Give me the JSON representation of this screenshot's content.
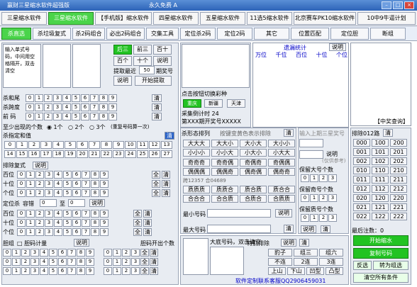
{
  "app": {
    "title": "赢财三星缩水软件超强版",
    "center": "永久免费 A"
  },
  "tabs": [
    "三星缩水软件",
    "三星缩水软件",
    "【手机版】缩水软件",
    "四星缩水软件",
    "五星缩水软件",
    "11选5缩水软件",
    "北京赛车PK10缩水软件",
    "10中9牛逼计划"
  ],
  "toolbar": [
    "杀直选",
    "杀垃圾复式",
    "杀2码组合",
    "必出2码组合",
    "交集工具",
    "定位杀2码",
    "定位2码",
    "其它",
    "位置匹配",
    "定位胆",
    "断组"
  ],
  "input": {
    "hint": "输入单式号码，中间用空格隔开，双击清空"
  },
  "extract": {
    "b1": "后三",
    "b2": "前三",
    "b3": "百十",
    "b4": "百个",
    "b5": "十个",
    "b6": "说明",
    "recent_label": "提取最近",
    "recent_value": "50",
    "period_label": "期奖号",
    "extract_btn": "开始提取",
    "explain": "说明"
  },
  "sumrows": {
    "hz": "杀和尾",
    "kd": "杀跨度",
    "qm": "前 码",
    "clear": "清"
  },
  "atleast": {
    "label": "至少出现的个数",
    "o1": "1个",
    "o2": "2个",
    "o3": "3个",
    "note": "(重复号码算一次)"
  },
  "killdan": {
    "label": "杀指定和值",
    "clear": "清"
  },
  "pos3": {
    "title": "排除复式",
    "explain": "说明",
    "rows": [
      "百位",
      "十位",
      "个位"
    ],
    "all": "全",
    "clear": "清"
  },
  "posdel": {
    "title": "定位杀",
    "label": "容错",
    "from": "0",
    "to_label": "至",
    "to": "0",
    "explain": "说明",
    "rows": [
      "百位",
      "十位",
      "个位"
    ],
    "all": "全",
    "clear": "清"
  },
  "lottery": {
    "title": "点击按钮切换彩种",
    "chongqing": "重庆",
    "xinjiang": "新疆",
    "tianjin": "天津",
    "countdown": "采集倒计时 24",
    "period": "第XXX期开奖号XXXXX"
  },
  "trend": {
    "title": "遗漏统计",
    "explain": "说明",
    "cols": [
      "万位",
      "千位",
      "百位",
      "十位",
      "个位"
    ]
  },
  "query": {
    "label": "【中奖查询】"
  },
  "shape": {
    "title": "杀形态排列",
    "sub": "按键变黄色表示排除",
    "clear": "清",
    "items": [
      "大大大",
      "大大小",
      "大小大",
      "大小小",
      "小小小",
      "小小大",
      "小大小",
      "小大大",
      "奇奇奇",
      "奇奇偶",
      "奇偶奇",
      "奇偶偶",
      "偶偶偶",
      "偶偶奇",
      "偶奇偶",
      "偶奇奇"
    ],
    "bars": [
      "质质质",
      "质质合",
      "质合质",
      "质合合",
      "合合合",
      "合合质",
      "合质合",
      "合质质"
    ],
    "note": "跨12357 合04689"
  },
  "minmax": {
    "min": "最小号码",
    "max": "最大号码",
    "explain": "说明",
    "clear": "清"
  },
  "award": {
    "title": "输入上期三星奖号",
    "explain": "说明",
    "note": "(仅供参考)"
  },
  "keep": {
    "big": "保留大号个数",
    "odd": "保留奇号个数",
    "prime": "保留质号个数"
  },
  "sort": {
    "title": "排除012路",
    "clear": "清",
    "items": [
      "000",
      "100",
      "200",
      "001",
      "101",
      "201",
      "002",
      "102",
      "202",
      "010",
      "110",
      "210",
      "011",
      "111",
      "211",
      "012",
      "112",
      "212",
      "020",
      "120",
      "220",
      "021",
      "121",
      "221",
      "022",
      "122",
      "222"
    ]
  },
  "bottom": {
    "group": "胆组",
    "bile_count": "胆码计量",
    "explain": "说明",
    "bile_open": "胆码开出个数",
    "bigbase": "大底号码，双击清空",
    "special": "特别排除",
    "sp": [
      "豹子",
      "组三",
      "组六",
      "不连",
      "2连",
      "3连",
      "上山",
      "下山",
      "凹型",
      "凸型"
    ],
    "clear": "清",
    "all": "全"
  },
  "result": {
    "label": "最后注数：",
    "value": "0",
    "start": "开始缩水",
    "copy": "复制号码",
    "invert": "反选",
    "togroup": "转为组选",
    "clearall": "清空所有条件"
  },
  "footer": "软件定制联系客服QQ2906459031"
}
